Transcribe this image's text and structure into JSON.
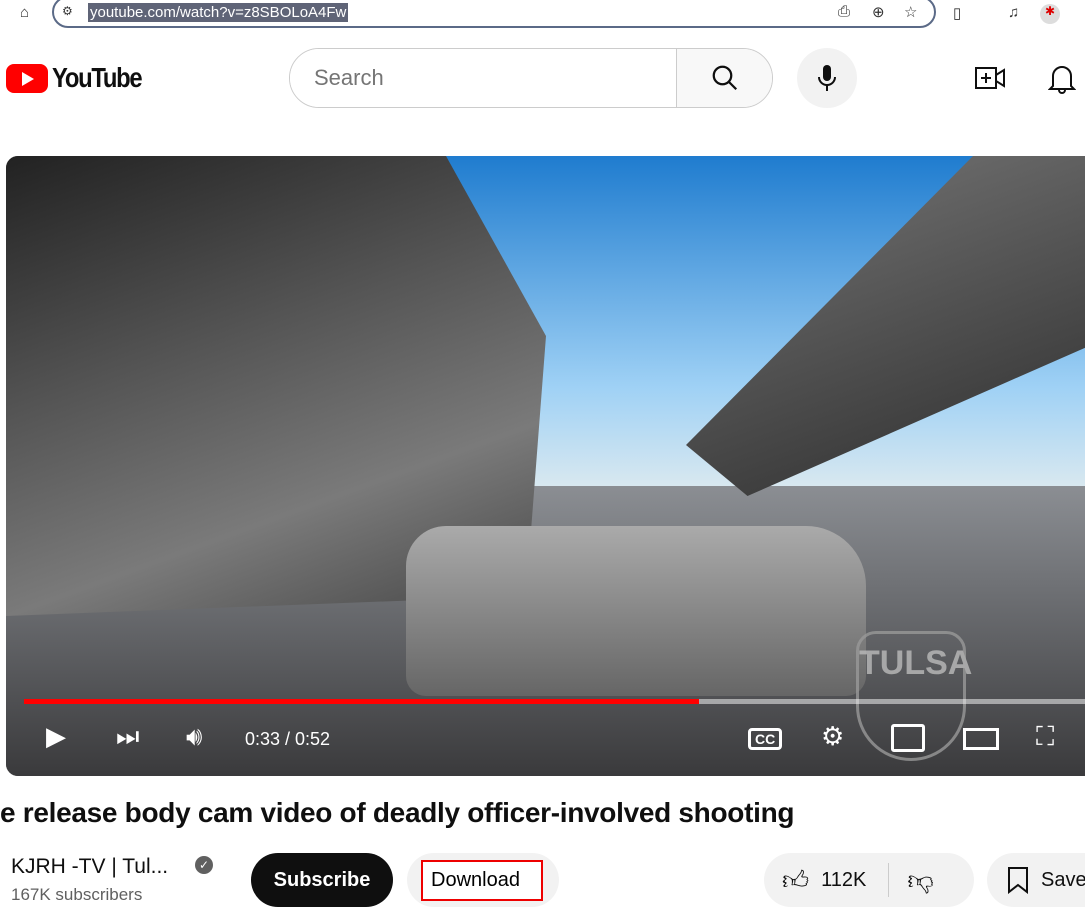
{
  "browser": {
    "url": "youtube.com/watch?v=z8SBOLoA4Fw"
  },
  "header": {
    "logo_text": "YouTube",
    "search_placeholder": "Search"
  },
  "player": {
    "current_time": "0:33",
    "duration": "0:52",
    "time_display": "0:33 / 0:52",
    "progress_percent": 63,
    "watermark": "TULSA POLICE",
    "accent": "#ff0000"
  },
  "video": {
    "title": "e release body cam video of deadly officer-involved shooting"
  },
  "channel": {
    "name": "KJRH -TV | Tul...",
    "subscribers": "167K subscribers"
  },
  "actions": {
    "subscribe": "Subscribe",
    "download": "Download",
    "likes": "112K",
    "save": "Save"
  }
}
